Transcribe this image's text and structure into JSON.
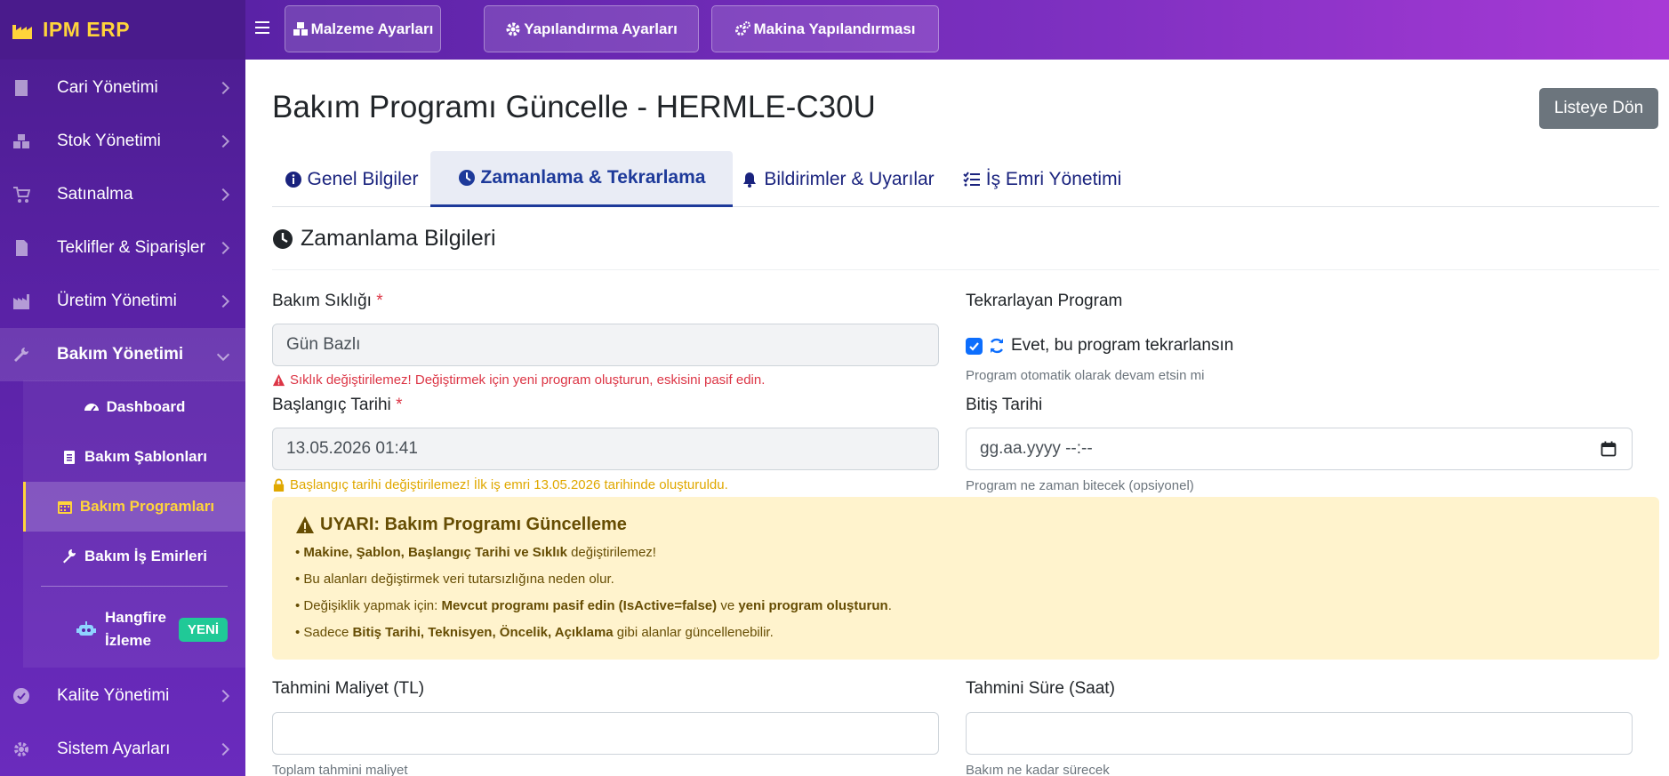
{
  "app": {
    "brand": "IPM ERP"
  },
  "topbar": {
    "buttons": [
      {
        "label": "Malzeme Ayarları"
      },
      {
        "label": "Yapılandırma Ayarları"
      },
      {
        "label": "Makina Yapılandırması"
      }
    ]
  },
  "sidebar": {
    "items": [
      {
        "label": "Cari Yönetimi"
      },
      {
        "label": "Stok Yönetimi"
      },
      {
        "label": "Satınalma"
      },
      {
        "label": "Teklifler & Siparişler"
      },
      {
        "label": "Üretim Yönetimi"
      },
      {
        "label": "Bakım Yönetimi"
      },
      {
        "label": "Kalite Yönetimi"
      },
      {
        "label": "Sistem Ayarları"
      }
    ],
    "submenu": [
      {
        "label": "Dashboard"
      },
      {
        "label": "Bakım Şablonları"
      },
      {
        "label": "Bakım Programları"
      },
      {
        "label": "Bakım İş Emirleri"
      }
    ],
    "hangfire": {
      "label": "Hangfire İzleme",
      "badge": "YENİ"
    }
  },
  "page": {
    "title": "Bakım Programı Güncelle - HERMLE-C30U",
    "back_label": "Listeye Dön",
    "tabs": [
      {
        "label": "Genel Bilgiler"
      },
      {
        "label": "Zamanlama & Tekrarlama"
      },
      {
        "label": "Bildirimler & Uyarılar"
      },
      {
        "label": "İş Emri Yönetimi"
      }
    ],
    "section_title": "Zamanlama Bilgileri"
  },
  "form": {
    "frequency": {
      "label": "Bakım Sıklığı",
      "required": "*",
      "value": "Gün Bazlı",
      "error": "Sıklık değiştirilemez! Değiştirmek için yeni program oluşturun, eskisini pasif edin."
    },
    "recurring": {
      "label": "Tekrarlayan Program",
      "checkbox_label": "Evet, bu program tekrarlansın",
      "help": "Program otomatik olarak devam etsin mi"
    },
    "start_date": {
      "label": "Başlangıç Tarihi",
      "required": "*",
      "value": "13.05.2026 01:41",
      "warning": "Başlangıç tarihi değiştirilemez! İlk iş emri 13.05.2026 tarihinde oluşturuldu."
    },
    "end_date": {
      "label": "Bitiş Tarihi",
      "placeholder": "gg.aa.yyyy --:--",
      "help": "Program ne zaman bitecek (opsiyonel)"
    },
    "estimated_cost": {
      "label": "Tahmini Maliyet (TL)",
      "help": "Toplam tahmini maliyet"
    },
    "estimated_duration": {
      "label": "Tahmini Süre (Saat)",
      "help": "Bakım ne kadar sürecek"
    }
  },
  "alert": {
    "title": "UYARI: Bakım Programı Güncelleme",
    "line1_bold": "Makine, Şablon, Başlangıç Tarihi ve Sıklık",
    "line1_rest": " değiştirilemez!",
    "line2": "Bu alanları değiştirmek veri tutarsızlığına neden olur.",
    "line3_a": "Değişiklik yapmak için: ",
    "line3_b": "Mevcut programı pasif edin (IsActive=false)",
    "line3_c": " ve ",
    "line3_d": "yeni program oluşturun",
    "line3_e": ".",
    "line4_a": "Sadece ",
    "line4_b": "Bitiş Tarihi, Teknisyen, Öncelik, Açıklama",
    "line4_c": " gibi alanlar güncellenebilir."
  }
}
